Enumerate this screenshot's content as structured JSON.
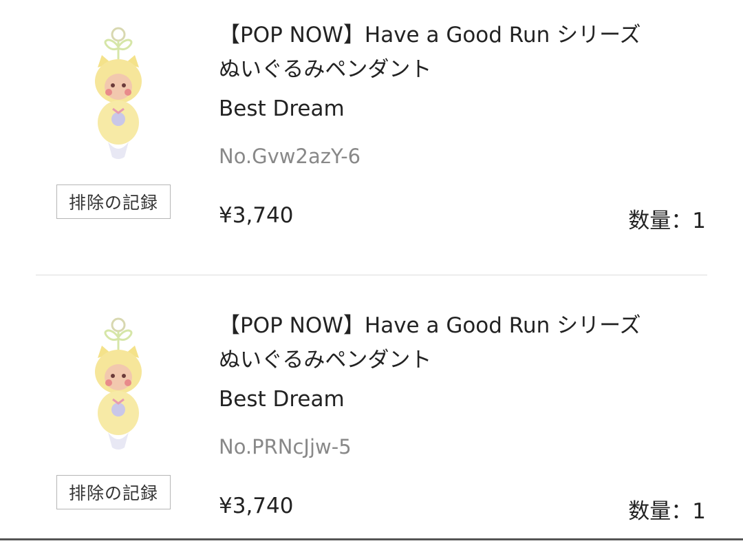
{
  "items": [
    {
      "title_line1": "【POP NOW】Have a Good Run シリーズ",
      "title_line2": "ぬいぐるみペンダント",
      "variant": "Best Dream",
      "sku": "No.Gvw2azY-6",
      "price": "¥3,740",
      "quantity": "数量：1",
      "exclude_label": "排除の記録",
      "thumbnail_icon": "plush-pendant-icon"
    },
    {
      "title_line1": "【POP NOW】Have a Good Run シリーズ",
      "title_line2": "ぬいぐるみペンダント",
      "variant": "Best Dream",
      "sku": "No.PRNcJjw-5",
      "price": "¥3,740",
      "quantity": "数量：1",
      "exclude_label": "排除の記録",
      "thumbnail_icon": "plush-pendant-icon"
    }
  ],
  "colors": {
    "text": "#222222",
    "muted": "#888888",
    "border": "#b5b5b5",
    "plush": "#f7e9a0"
  }
}
